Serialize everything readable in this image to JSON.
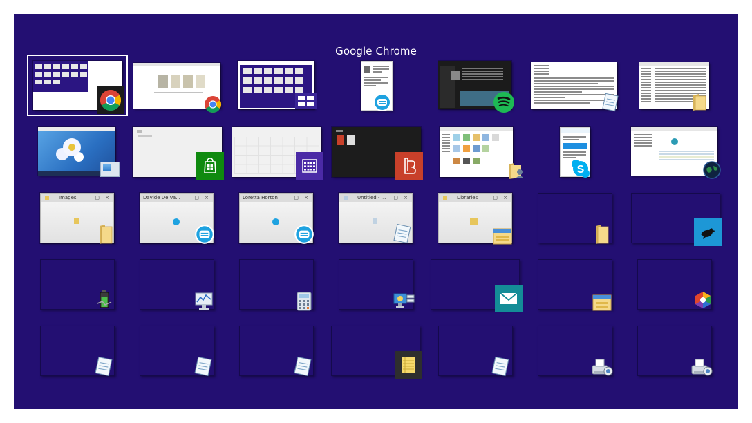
{
  "header": {
    "title": "Google Chrome"
  },
  "windows": {
    "row1": [
      "chrome-switcher",
      "chrome-web",
      "app-switcher",
      "messenger",
      "spotify",
      "notepad-text",
      "explorer-details"
    ],
    "row2": [
      "desktop",
      "store",
      "calendar",
      "reader",
      "explorer-icons",
      "skype",
      "browser-page"
    ],
    "row3": [
      {
        "title": "Images",
        "icon": "folder-icon"
      },
      {
        "title": "Davide De Va...",
        "icon": "messenger-icon"
      },
      {
        "title": "Loretta Horton",
        "icon": "messenger-icon"
      },
      {
        "title": "Untitled - ...",
        "icon": "notepad-icon"
      },
      {
        "title": "Libraries",
        "icon": "file-explorer-icon"
      },
      {
        "title": "",
        "icon": "folder-icon"
      },
      {
        "title": "",
        "icon": "bird-app-icon"
      }
    ]
  },
  "colors": {
    "background": "#230f72",
    "page": "#ffffff",
    "store": "#0f8a0f",
    "calendar": "#4b2aa6",
    "reader": "#c8402a",
    "mail": "#148c97",
    "spotify": "#1db954"
  }
}
